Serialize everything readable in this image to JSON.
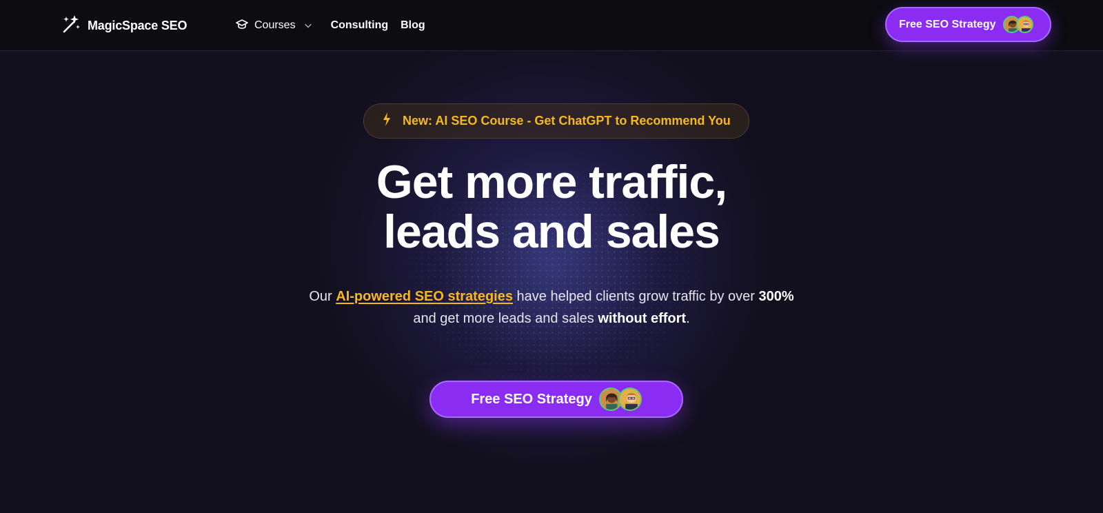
{
  "header": {
    "brand_name": "MagicSpace SEO",
    "nav": {
      "courses_label": "Courses",
      "consulting_label": "Consulting",
      "blog_label": "Blog"
    },
    "cta_label": "Free SEO Strategy"
  },
  "hero": {
    "announcement": "New: AI SEO Course - Get ChatGPT to Recommend You",
    "headline_line1": "Get more traffic,",
    "headline_line2": "leads and sales",
    "sub": {
      "part1": "Our ",
      "highlight": "AI-powered SEO strategies",
      "part2": " have helped clients grow traffic by over ",
      "bold1": "300%",
      "part3": " and get more leads and sales ",
      "bold2": "without effort",
      "part4": "."
    },
    "cta_label": "Free SEO Strategy"
  },
  "colors": {
    "background": "#12101e",
    "header_bg": "#0c0c11",
    "accent_purple": "#8b2cf2",
    "accent_yellow": "#f6b81c"
  },
  "icons": {
    "brand": "magic-wand-sparkles-icon",
    "courses": "graduation-cap-icon",
    "dropdown": "chevron-down-icon",
    "announcement": "lightning-bolt-icon"
  }
}
